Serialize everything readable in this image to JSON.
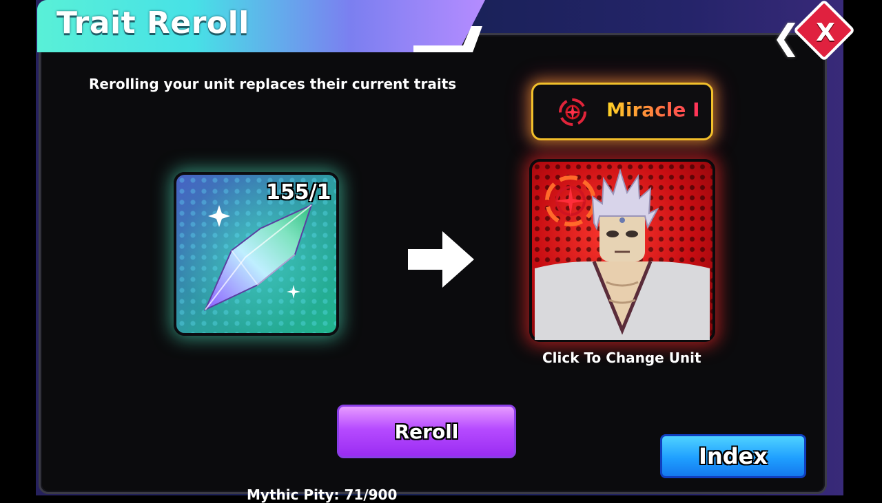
{
  "window": {
    "title": "Trait Reroll"
  },
  "header": {
    "description": "Rerolling your unit replaces their current traits"
  },
  "crystal": {
    "count_label": "155/1",
    "icon": "trait-crystal-icon"
  },
  "trait": {
    "name": "Miracle I",
    "icon": "miracle-trait-icon"
  },
  "unit": {
    "caption": "Click To Change Unit",
    "portrait": "white-haired-unit-portrait"
  },
  "buttons": {
    "reroll_label": "Reroll",
    "index_label": "Index",
    "close_label": "X"
  },
  "footer": {
    "pity_text": "Mythic Pity: 71/900"
  },
  "colors": {
    "title_gradient": [
      "#59f0d7",
      "#b58cff"
    ],
    "reroll_button": "#b64bff",
    "index_button": "#1f9fff",
    "close_button": "#e0213f",
    "trait_gold": "#ffd326",
    "unit_card_red": "#c70d12"
  }
}
